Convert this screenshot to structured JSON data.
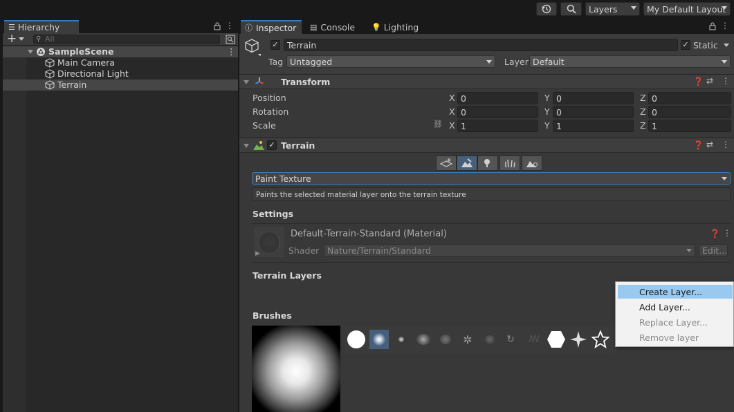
{
  "toolbar": {
    "history_icon": "history-icon",
    "search_icon": "search-icon",
    "layers_label": "Layers",
    "layout_label": "My Default Layout"
  },
  "hierarchy": {
    "tab_label": "Hierarchy",
    "search_placeholder": "All",
    "scene": "SampleScene",
    "items": [
      "Main Camera",
      "Directional Light",
      "Terrain"
    ]
  },
  "inspector": {
    "tabs": [
      "Inspector",
      "Console",
      "Lighting"
    ],
    "object_name": "Terrain",
    "static_label": "Static",
    "tag_label": "Tag",
    "tag_value": "Untagged",
    "layer_label": "Layer",
    "layer_value": "Default",
    "transform": {
      "title": "Transform",
      "rows": [
        {
          "label": "Position",
          "x": "0",
          "y": "0",
          "z": "0"
        },
        {
          "label": "Rotation",
          "x": "0",
          "y": "0",
          "z": "0"
        },
        {
          "label": "Scale",
          "x": "1",
          "y": "1",
          "z": "1"
        }
      ],
      "axis": [
        "X",
        "Y",
        "Z"
      ]
    },
    "terrain": {
      "title": "Terrain",
      "mode": "Paint Texture",
      "mode_description": "Paints the selected material layer onto the terrain texture",
      "settings_label": "Settings",
      "material_name": "Default-Terrain-Standard (Material)",
      "shader_label": "Shader",
      "shader_value": "Nature/Terrain/Standard",
      "edit_label": "Edit...",
      "terrain_layers_label": "Terrain Layers",
      "brushes_label": "Brushes"
    }
  },
  "context_menu": {
    "items": [
      "Create Layer...",
      "Add Layer...",
      "Replace Layer...",
      "Remove layer"
    ]
  },
  "colors": {
    "accent": "#3a79bb",
    "selected_menu": "#99c9ef",
    "panel": "#383838"
  }
}
